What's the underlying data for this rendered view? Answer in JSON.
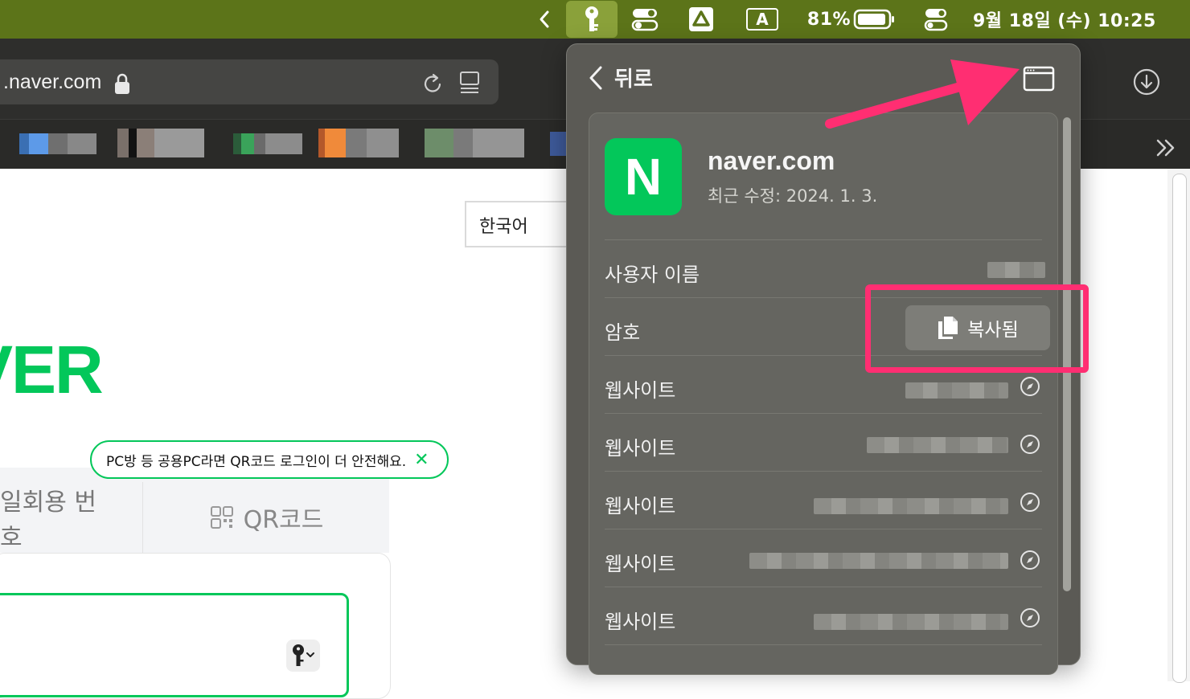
{
  "menubar": {
    "battery_percent": "81%",
    "clock": "9월 18일 (수) 10:25",
    "input_source": "A"
  },
  "browser": {
    "url": ".naver.com"
  },
  "page": {
    "language_select": "한국어",
    "logo_text": "VER",
    "qr_tooltip": "PC방 등 공용PC라면 QR코드 로그인이 더 안전해요.",
    "tooltip_close": "✕",
    "tabs": {
      "onetime": "일회용 번호",
      "qr": "QR코드"
    }
  },
  "popover": {
    "back_label": "뒤로",
    "site_name": "naver.com",
    "site_icon_letter": "N",
    "last_modified": "최근 수정: 2024. 1. 3.",
    "rows": {
      "username_label": "사용자 이름",
      "password_label": "암호",
      "copy_button_label": "복사됨",
      "website_label": "웹사이트"
    },
    "website_count": 5
  },
  "colors": {
    "naver_green": "#03c75a",
    "highlight_pink": "#ff2e72",
    "menubar_green": "#5c7419"
  }
}
